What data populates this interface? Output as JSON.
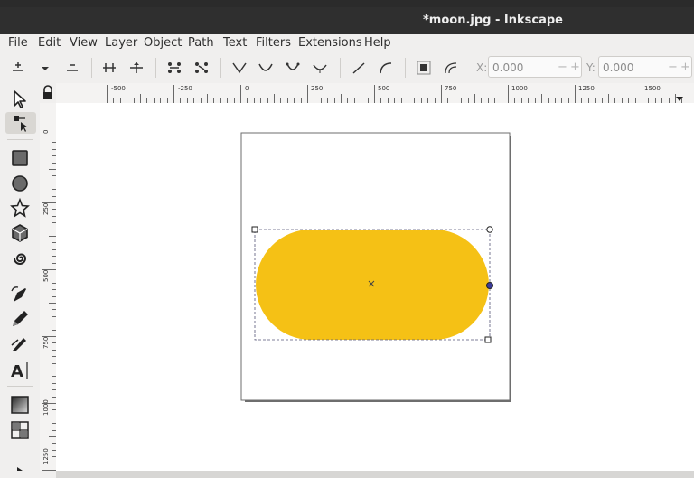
{
  "window": {
    "title": "*moon.jpg - Inkscape"
  },
  "menu": [
    "File",
    "Edit",
    "View",
    "Layer",
    "Object",
    "Path",
    "Text",
    "Filters",
    "Extensions",
    "Help"
  ],
  "toolbar": {
    "x_label": "X:",
    "x_value": "0.000",
    "y_label": "Y:",
    "y_value": "0.000",
    "minus": "−",
    "plus": "+"
  },
  "ruler": {
    "h_labels": [
      "-500",
      "-250",
      "0",
      "250",
      "500",
      "750",
      "1000",
      "1250",
      "1500"
    ],
    "v_labels": [
      "0",
      "250",
      "500",
      "750",
      "1000",
      "1250"
    ]
  },
  "tools": [
    "selector-tool",
    "node-tool",
    "rectangle-tool",
    "ellipse-tool",
    "star-tool",
    "3dbox-tool",
    "spiral-tool",
    "pen-tool",
    "pencil-tool",
    "calligraphy-tool",
    "text-tool",
    "gradient-tool",
    "mesh-tool"
  ],
  "shape": {
    "fill": "#f5c115"
  },
  "colors": {
    "titlebar": "#2f2f2f",
    "canvas": "#ffffff",
    "selection": "#3b3b9a"
  }
}
